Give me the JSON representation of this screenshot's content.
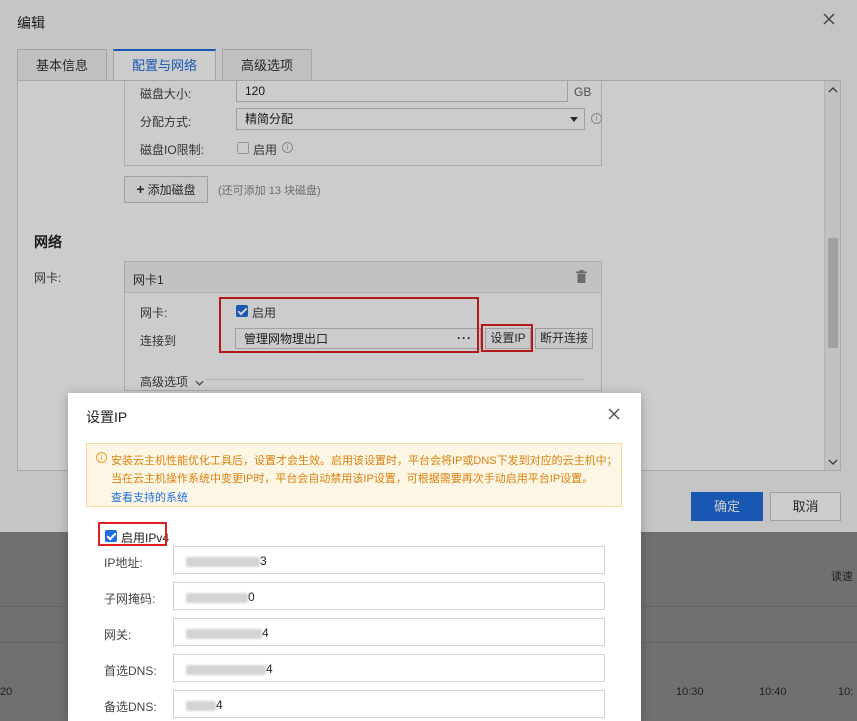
{
  "edit_dialog": {
    "title": "编辑",
    "tabs": [
      {
        "label": "基本信息",
        "active": false
      },
      {
        "label": "配置与网络",
        "active": true
      },
      {
        "label": "高级选项",
        "active": false
      }
    ],
    "disk": {
      "size_label": "磁盘大小:",
      "size_value": "120",
      "size_unit": "GB",
      "alloc_label": "分配方式:",
      "alloc_value": "精简分配",
      "io_label": "磁盘IO限制:",
      "io_checkbox_label": "启用",
      "io_enabled": false,
      "add_disk_button": "添加磁盘",
      "add_disk_hint": "(还可添加 13 块磁盘)"
    },
    "network": {
      "section_title": "网络",
      "nic_label": "网卡:",
      "nic_title": "网卡1",
      "nic_enable_label": "网卡:",
      "nic_enable_checkbox": "启用",
      "nic_enabled": true,
      "connect_label": "连接到",
      "connect_value": "管理网物理出口",
      "set_ip_button": "设置IP",
      "disconnect_button": "断开连接",
      "advanced_label": "高级选项"
    },
    "footer": {
      "confirm_label": "确定",
      "cancel_label": "取消"
    }
  },
  "background": {
    "right_label": "读速",
    "ticks": [
      "20",
      "10:30",
      "10:40",
      "10:"
    ]
  },
  "ip_dialog": {
    "title": "设置IP",
    "notice_line1": "安装云主机性能优化工具后，设置才会生效。启用该设置时，平台会将IP或DNS下发到对应的云主机中；",
    "notice_line2": "当在云主机操作系统中变更IP时，平台会自动禁用该IP设置，可根据需要再次手动启用平台IP设置。",
    "notice_link": "查看支持的系统",
    "ipv4_checkbox_label": "启用IPv4",
    "ipv4_enabled": true,
    "fields": [
      {
        "label": "IP地址:",
        "value_prefix": "",
        "value_suffix": "3"
      },
      {
        "label": "子网掩码:",
        "value_prefix": "",
        "value_suffix": "0"
      },
      {
        "label": "网关:",
        "value_prefix": "",
        "value_suffix": "4"
      },
      {
        "label": "首选DNS:",
        "value_prefix": "",
        "value_suffix": "4"
      },
      {
        "label": "备选DNS:",
        "value_prefix": "",
        "value_suffix": "4"
      }
    ]
  },
  "colors": {
    "primary": "#1f6fe0",
    "highlight": "#e02020",
    "notice_text": "#d9820f",
    "notice_bg": "#fdf6e4"
  }
}
